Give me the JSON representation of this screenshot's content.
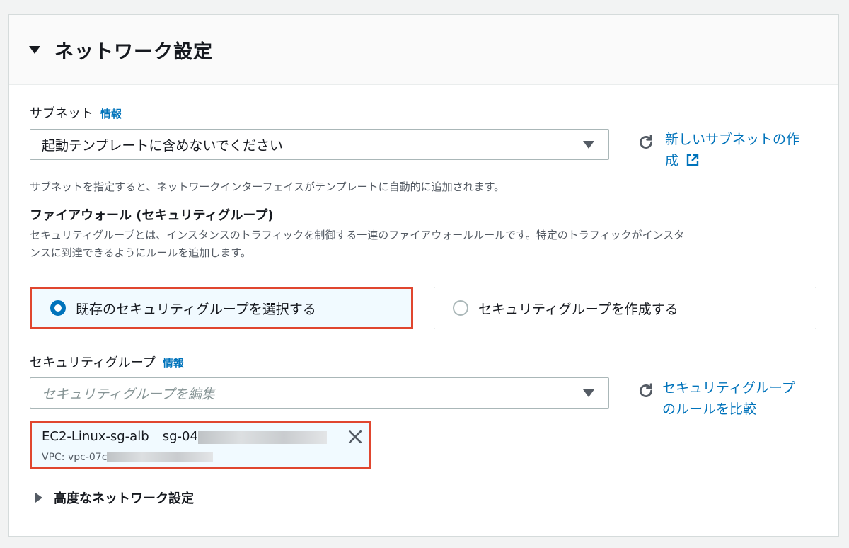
{
  "section": {
    "title": "ネットワーク設定"
  },
  "subnet": {
    "label": "サブネット",
    "info": "情報",
    "selected_value": "起動テンプレートに含めないでください",
    "new_link": "新しいサブネットの作成",
    "new_link_line1": "新しいサブネットの作",
    "new_link_line2": "成",
    "description": "サブネットを指定すると、ネットワークインターフェイスがテンプレートに自動的に追加されます。"
  },
  "firewall": {
    "heading": "ファイアウォール (セキュリティグループ)",
    "description_line1": "セキュリティグループとは、インスタンスのトラフィックを制御する一連のファイアウォールルールです。特定のトラフィックがインスタ",
    "description_line2": "ンスに到達できるようにルールを追加します。",
    "option_existing": "既存のセキュリティグループを選択する",
    "option_create": "セキュリティグループを作成する"
  },
  "security_group": {
    "label": "セキュリティグループ",
    "info": "情報",
    "placeholder": "セキュリティグループを編集",
    "compare_link_line1": "セキュリティグループ",
    "compare_link_line2": "のルールを比較",
    "token": {
      "name": "EC2-Linux-sg-alb",
      "id_prefix": "sg-04",
      "vpc_prefix": "VPC: vpc-07c"
    }
  },
  "advanced": {
    "label": "高度なネットワーク設定"
  },
  "colors": {
    "link": "#0073bb",
    "highlight": "#e0462f",
    "selected_bg": "#f1faff"
  }
}
